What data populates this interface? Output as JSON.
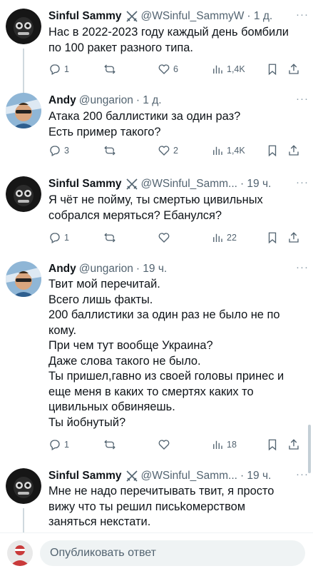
{
  "tweets": [
    {
      "name": "Sinful Sammy",
      "handle": "@WSinful_SammyW",
      "time": "· 1 д.",
      "lines": [
        "Нас в 2022-2023 году каждый день бомбили",
        "по 100 ракет разного типа."
      ],
      "stats": {
        "replies": "1",
        "retweets": "",
        "likes": "6",
        "views": "1,4K"
      }
    },
    {
      "name": "Andy",
      "handle": "@ungarion",
      "time": "· 1 д.",
      "lines": [
        "Атака 200 баллистики за один раз?",
        "Есть пример такого?"
      ],
      "stats": {
        "replies": "3",
        "retweets": "",
        "likes": "2",
        "views": "1,4K"
      }
    },
    {
      "name": "Sinful Sammy",
      "handle": "@WSinful_Samm...",
      "time": "· 19 ч.",
      "lines": [
        "Я чёт не пойму, ты смертью цивильных",
        "собрался меряться? Ебанулся?"
      ],
      "stats": {
        "replies": "1",
        "retweets": "",
        "likes": "",
        "views": "22"
      }
    },
    {
      "name": "Andy",
      "handle": "@ungarion",
      "time": "· 19 ч.",
      "lines": [
        "Твит мой перечитай.",
        "Всего лишь факты.",
        "200 баллистики за один раз не было не по",
        "кому.",
        "При чем тут вообще Украина?",
        "Даже слова такого не было.",
        "Ты пришел,гавно из своей головы принес и",
        "еще меня в каких то смертях каких то",
        "цивильных обвиняешь.",
        "Ты йобнутый?"
      ],
      "stats": {
        "replies": "1",
        "retweets": "",
        "likes": "",
        "views": "18"
      }
    },
    {
      "name": "Sinful Sammy",
      "handle": "@WSinful_Samm...",
      "time": "· 19 ч.",
      "lines": [
        "Мне не надо перечитывать твит, я просто",
        "вижу что ты решил письkомерством",
        "заняться некстати."
      ],
      "stats": {
        "replies": "",
        "retweets": "",
        "likes": "",
        "views": ""
      }
    }
  ],
  "more_glyph": "···",
  "reply": {
    "placeholder": "Опубликовать ответ"
  },
  "colors": {
    "text": "#0f1419",
    "secondary": "#536471",
    "line": "#cfd9de",
    "input_bg": "#eff3f4"
  }
}
